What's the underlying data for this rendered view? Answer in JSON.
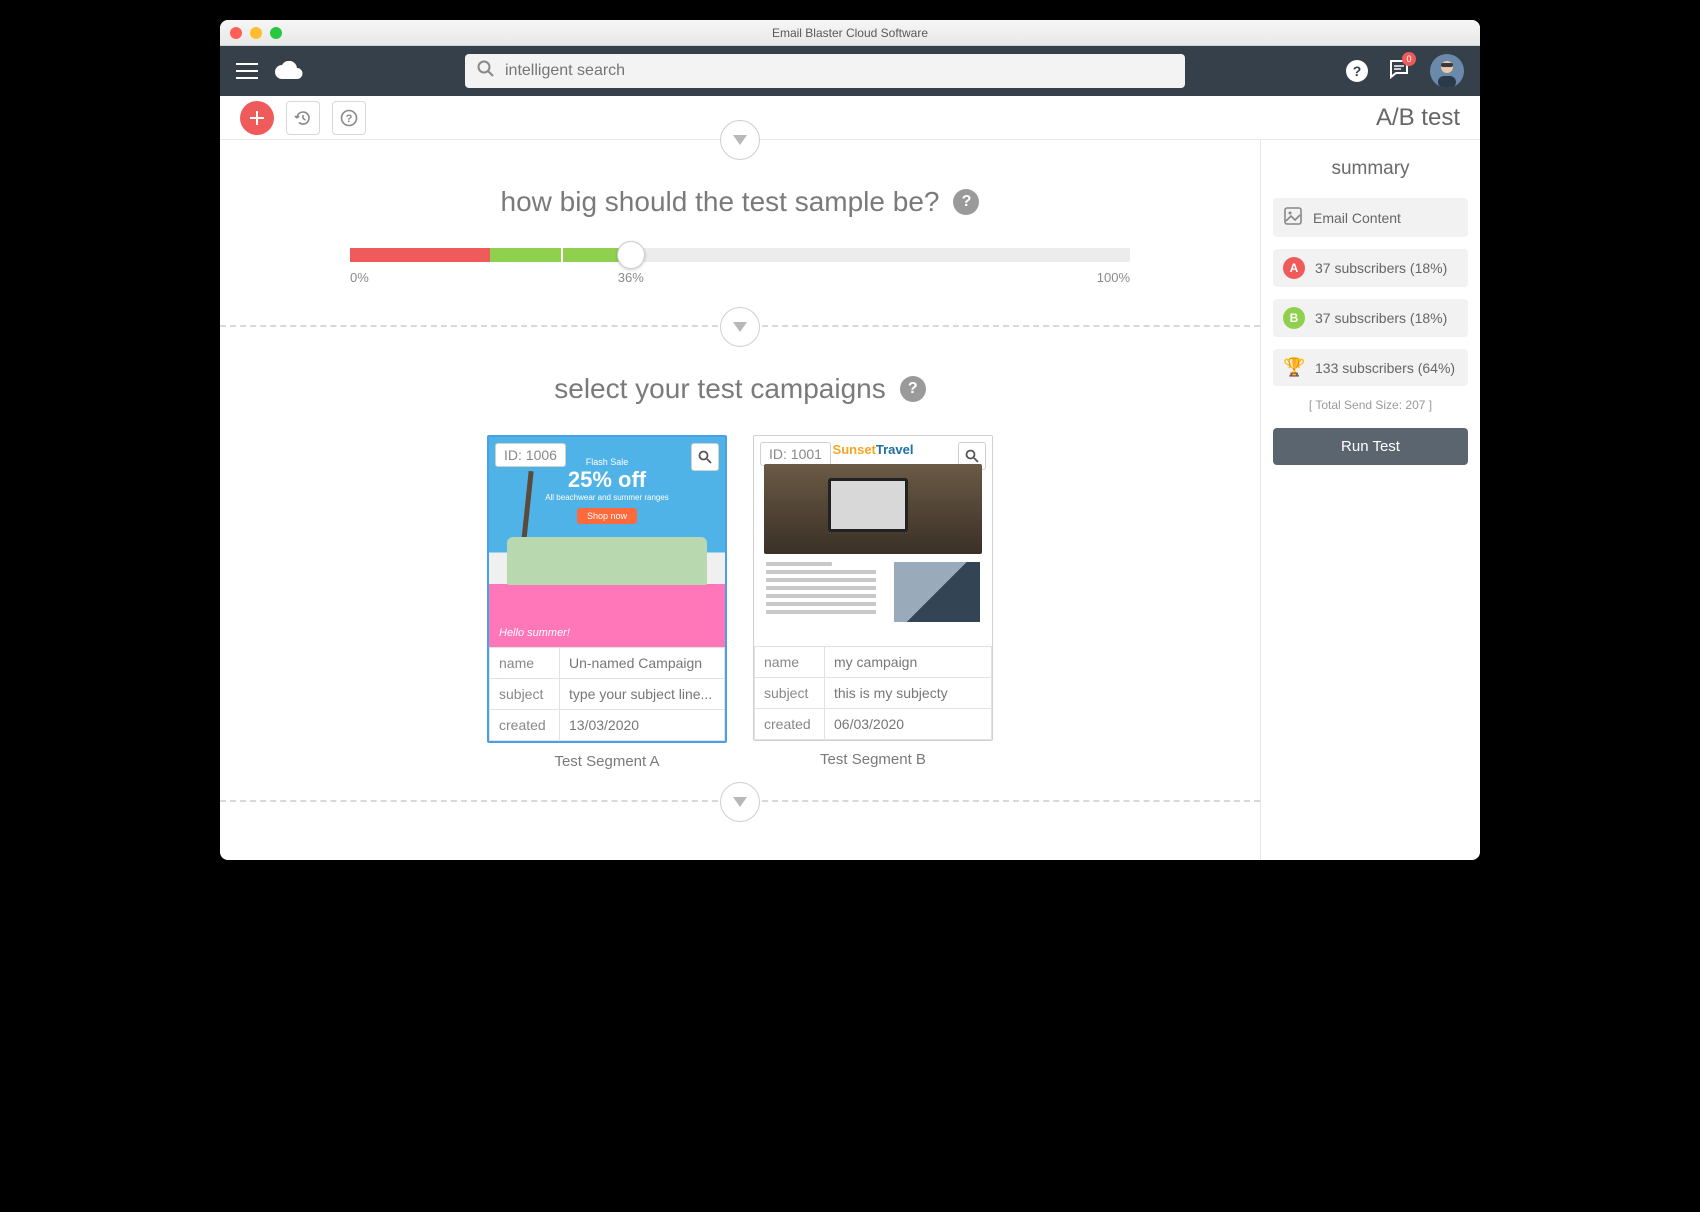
{
  "window_title": "Email Blaster Cloud Software",
  "search_placeholder": "intelligent search",
  "chat_badge": "0",
  "page_title": "A/B test",
  "section_sample": {
    "heading": "how big should the test sample be?",
    "min_label": "0%",
    "value_label": "36%",
    "max_label": "100%"
  },
  "section_campaigns": {
    "heading": "select your test campaigns"
  },
  "cards": [
    {
      "id_label": "ID: 1006",
      "hero_flash": "Flash Sale",
      "hero_pct": "25% off",
      "hero_sub": "All beachwear and summer ranges",
      "hero_cta": "Shop now",
      "hero_hello": "Hello summer!",
      "meta_name_label": "name",
      "meta_name": "Un-named Campaign",
      "meta_subject_label": "subject",
      "meta_subject": "type your subject line...",
      "meta_created_label": "created",
      "meta_created": "13/03/2020",
      "segment_label": "Test Segment A"
    },
    {
      "id_label": "ID: 1001",
      "brand_a": "Sunset",
      "brand_b": "Travel",
      "meta_name_label": "name",
      "meta_name": "my campaign",
      "meta_subject_label": "subject",
      "meta_subject": "this is my subjecty",
      "meta_created_label": "created",
      "meta_created": "06/03/2020",
      "segment_label": "Test Segment B"
    }
  ],
  "summary": {
    "heading": "summary",
    "email_content": "Email Content",
    "a_line": "37 subscribers (18%)",
    "b_line": "37 subscribers (18%)",
    "winner_line": "133 subscribers (64%)",
    "total_line": "[ Total Send Size: 207 ]",
    "run_label": "Run Test"
  }
}
